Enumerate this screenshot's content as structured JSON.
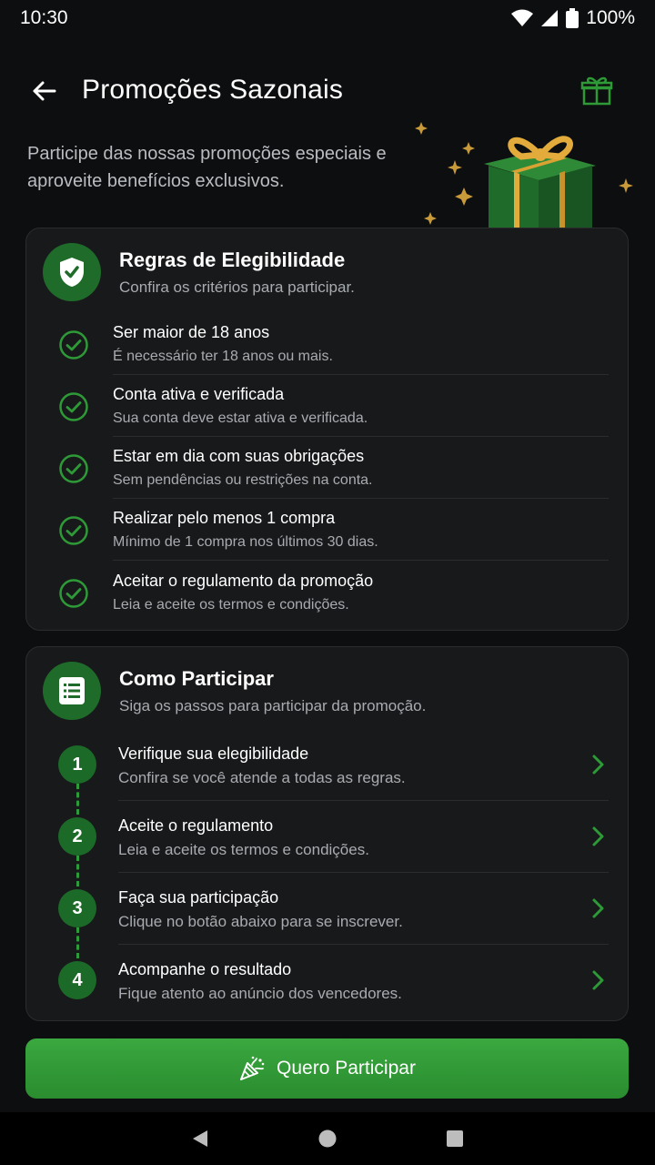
{
  "status": {
    "time": "10:30",
    "battery": "100%"
  },
  "header": {
    "title": "Promoções Sazonais"
  },
  "intro": "Participe das nossas promoções especiais e aproveite benefícios exclusivos.",
  "rules_card": {
    "title": "Regras de Elegibilidade",
    "subtitle": "Confira os critérios para participar.",
    "items": [
      {
        "title": "Ser maior de 18 anos",
        "desc": "É necessário ter 18 anos ou mais."
      },
      {
        "title": "Conta ativa e verificada",
        "desc": "Sua conta deve estar ativa e verificada."
      },
      {
        "title": "Estar em dia com suas obrigações",
        "desc": "Sem pendências ou restrições na conta."
      },
      {
        "title": "Realizar pelo menos 1 compra",
        "desc": "Mínimo de 1 compra nos últimos 30 dias."
      },
      {
        "title": "Aceitar o regulamento da promoção",
        "desc": "Leia e aceite os termos e condições."
      }
    ]
  },
  "steps_card": {
    "title": "Como Participar",
    "subtitle": "Siga os passos para participar da promoção.",
    "steps": [
      {
        "num": "1",
        "title": "Verifique sua elegibilidade",
        "desc": "Confira se você atende a todas as regras."
      },
      {
        "num": "2",
        "title": "Aceite o regulamento",
        "desc": "Leia e aceite os termos e condições."
      },
      {
        "num": "3",
        "title": "Faça sua participação",
        "desc": "Clique no botão abaixo para se inscrever."
      },
      {
        "num": "4",
        "title": "Acompanhe o resultado",
        "desc": "Fique atento ao anúncio dos vencedores."
      }
    ]
  },
  "cta": {
    "label": "Quero Participar"
  },
  "colors": {
    "accent": "#2e9a37",
    "background": "#0d0e0f",
    "card": "#18191b"
  },
  "icons": [
    "back-arrow-icon",
    "gift-icon",
    "shield-check-icon",
    "check-circle-icon",
    "list-icon",
    "chevron-right-icon",
    "party-popper-icon"
  ]
}
